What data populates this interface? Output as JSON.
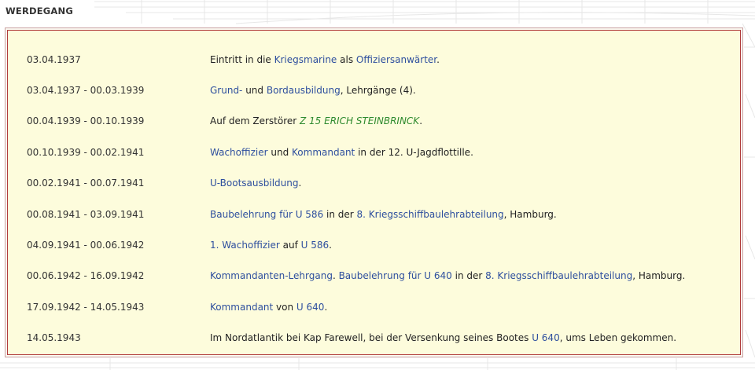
{
  "section": {
    "heading": "WERDEGANG"
  },
  "colors": {
    "link": "#2e4f9e",
    "ship": "#2e8a2e",
    "box_border": "#b03a3a",
    "box_fill": "#fdfcdc"
  },
  "timeline": [
    {
      "date": "03.04.1937",
      "event": [
        {
          "t": "Eintritt in die "
        },
        {
          "t": "Kriegsmarine",
          "link": true
        },
        {
          "t": " als "
        },
        {
          "t": "Offiziersanwärter",
          "link": true
        },
        {
          "t": "."
        }
      ]
    },
    {
      "date": "03.04.1937 - 00.03.1939",
      "event": [
        {
          "t": "Grund-",
          "link": true
        },
        {
          "t": " und "
        },
        {
          "t": "Bordausbildung",
          "link": true
        },
        {
          "t": ", Lehrgänge (4)."
        }
      ]
    },
    {
      "date": "00.04.1939 - 00.10.1939",
      "event": [
        {
          "t": "Auf dem Zerstörer "
        },
        {
          "t": "Z 15 ERICH STEINBRINCK",
          "ship": true
        },
        {
          "t": "."
        }
      ]
    },
    {
      "date": "00.10.1939 - 00.02.1941",
      "event": [
        {
          "t": "Wachoffizier",
          "link": true
        },
        {
          "t": " und "
        },
        {
          "t": "Kommandant",
          "link": true
        },
        {
          "t": " in der 12. U-Jagdflottille."
        }
      ]
    },
    {
      "date": "00.02.1941 - 00.07.1941",
      "event": [
        {
          "t": "U-Bootsausbildung",
          "link": true
        },
        {
          "t": "."
        }
      ]
    },
    {
      "date": "00.08.1941 - 03.09.1941",
      "event": [
        {
          "t": "Baubelehrung",
          "link": true
        },
        {
          "t": " "
        },
        {
          "t": "für",
          "link": true
        },
        {
          "t": " "
        },
        {
          "t": "U 586",
          "link": true
        },
        {
          "t": " in der "
        },
        {
          "t": "8. Kriegsschiffbaulehrabteilung",
          "link": true
        },
        {
          "t": ", Hamburg."
        }
      ]
    },
    {
      "date": "04.09.1941 - 00.06.1942",
      "event": [
        {
          "t": "1. Wachoffizier",
          "link": true
        },
        {
          "t": " auf "
        },
        {
          "t": "U 586",
          "link": true
        },
        {
          "t": "."
        }
      ]
    },
    {
      "date": "00.06.1942 - 16.09.1942",
      "event": [
        {
          "t": "Kommandanten-Lehrgang",
          "link": true
        },
        {
          "t": ". "
        },
        {
          "t": "Baubelehrung",
          "link": true
        },
        {
          "t": " "
        },
        {
          "t": "für",
          "link": true
        },
        {
          "t": " "
        },
        {
          "t": "U 640",
          "link": true
        },
        {
          "t": " in der "
        },
        {
          "t": "8. Kriegsschiffbaulehrabteilung",
          "link": true
        },
        {
          "t": ", Hamburg."
        }
      ]
    },
    {
      "date": "17.09.1942 - 14.05.1943",
      "event": [
        {
          "t": "Kommandant",
          "link": true
        },
        {
          "t": " von "
        },
        {
          "t": "U 640",
          "link": true
        },
        {
          "t": "."
        }
      ]
    },
    {
      "date": "14.05.1943",
      "event": [
        {
          "t": "Im Nordatlantik bei Kap Farewell, bei der Versenkung seines Bootes "
        },
        {
          "t": "U 640",
          "link": true
        },
        {
          "t": ", ums Leben gekommen."
        }
      ]
    }
  ]
}
